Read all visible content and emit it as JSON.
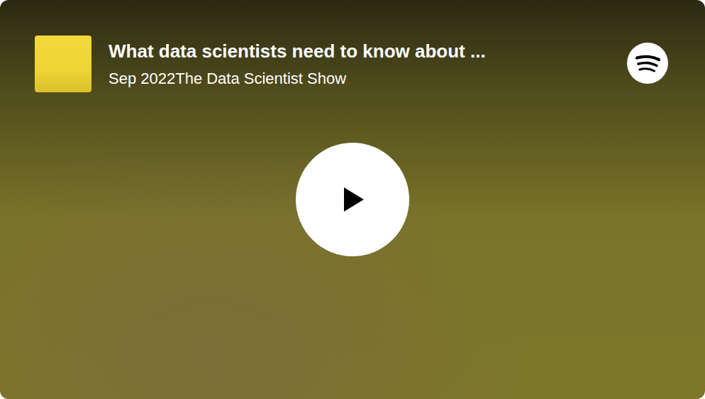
{
  "player": {
    "title": "What data scientists need to know about ...",
    "date": "Sep 2022",
    "show": "The Data Scientist Show",
    "playing": false
  }
}
